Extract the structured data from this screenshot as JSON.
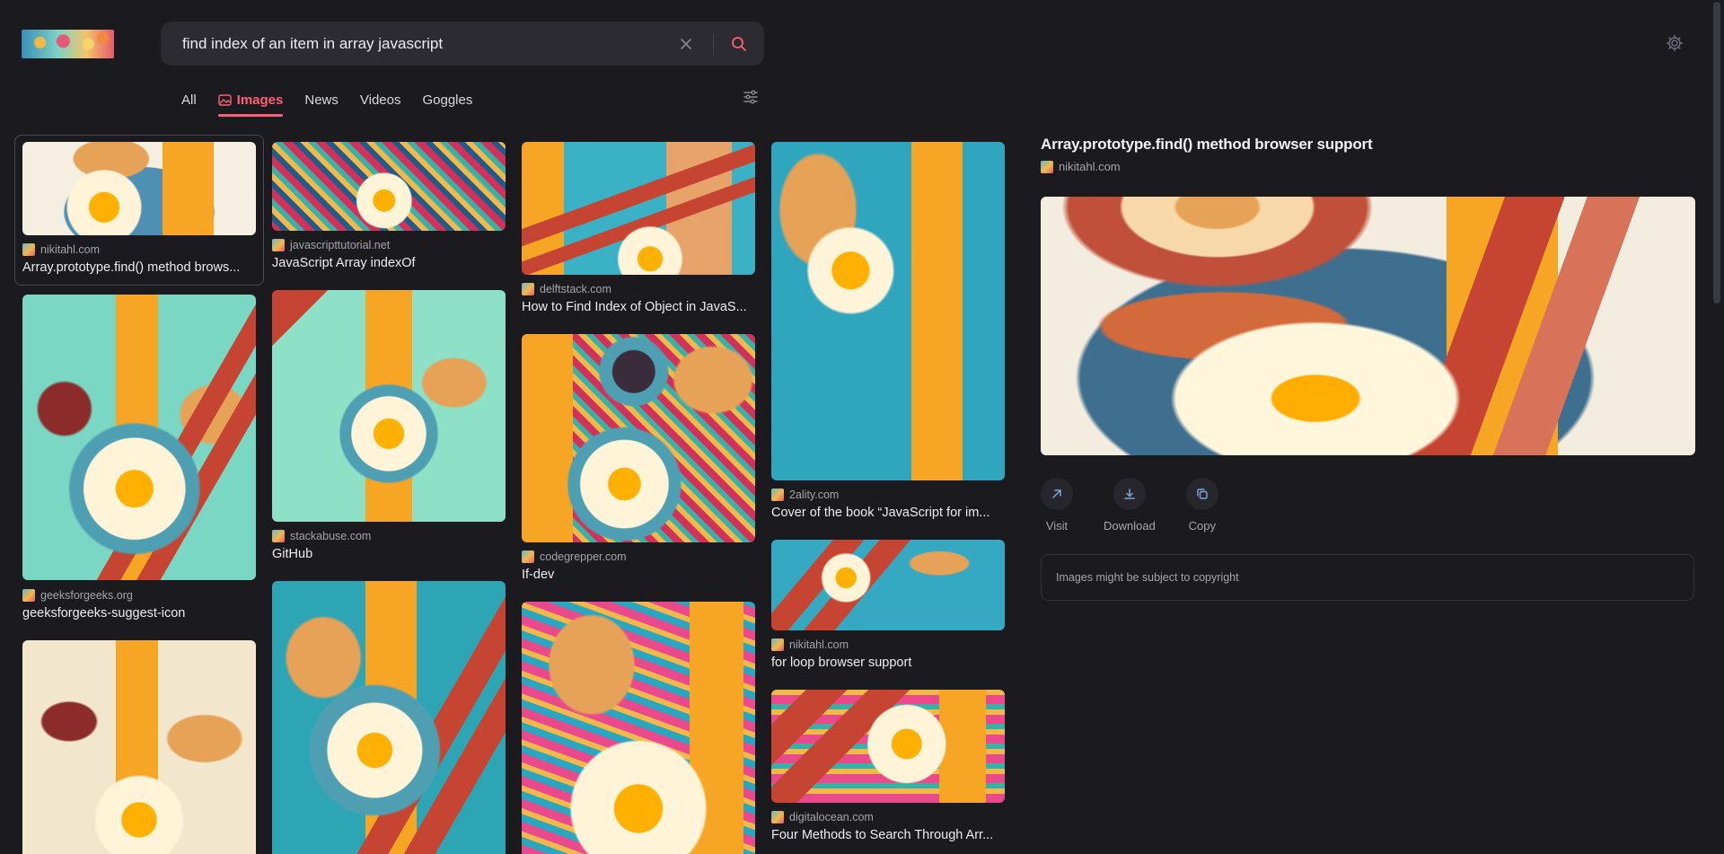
{
  "search": {
    "query": "find index of an item in array javascript"
  },
  "tabs": [
    {
      "label": "All"
    },
    {
      "label": "Images"
    },
    {
      "label": "News"
    },
    {
      "label": "Videos"
    },
    {
      "label": "Goggles"
    }
  ],
  "results": [
    {
      "source": "nikitahl.com",
      "title": "Array.prototype.find() method brows..."
    },
    {
      "source": "geeksforgeeks.org",
      "title": "geeksforgeeks-suggest-icon"
    },
    {
      "source": "javascripttutorial.net",
      "title": "JavaScript Array indexOf"
    },
    {
      "source": "stackabuse.com",
      "title": "GitHub"
    },
    {
      "source": "delftstack.com",
      "title": "How to Find Index of Object in JavaS..."
    },
    {
      "source": "codegrepper.com",
      "title": "If-dev"
    },
    {
      "source": "2ality.com",
      "title": "Cover of the book “JavaScript for im..."
    },
    {
      "source": "nikitahl.com",
      "title": "for loop browser support"
    },
    {
      "source": "digitalocean.com",
      "title": "Four Methods to Search Through Arr..."
    }
  ],
  "detail": {
    "title": "Array.prototype.find() method browser support",
    "source": "nikitahl.com",
    "actions": {
      "visit": "Visit",
      "download": "Download",
      "copy": "Copy"
    },
    "copyright": "Images might be subject to copyright"
  },
  "colors": {
    "accent": "#ff5e78",
    "background": "#1b1b1f",
    "surface": "#2b2b31"
  }
}
